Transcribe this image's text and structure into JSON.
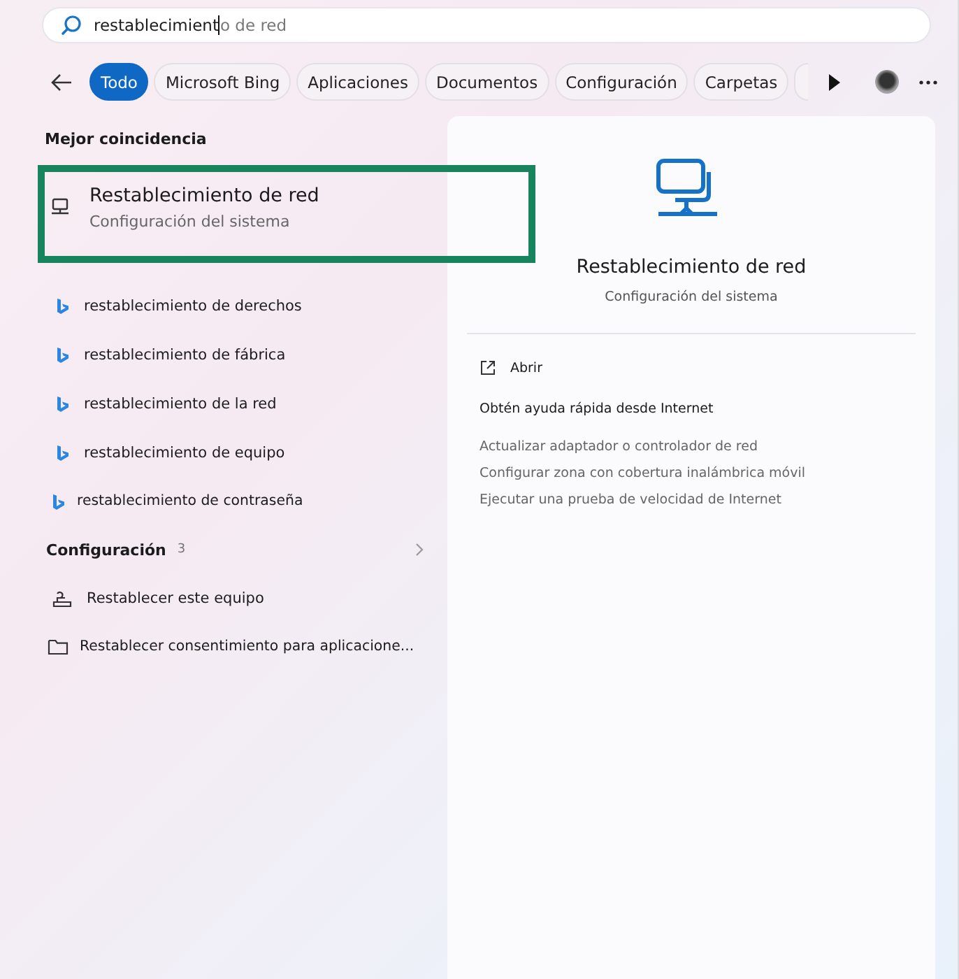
{
  "search": {
    "typed": "restablecimient",
    "completion": "o de red"
  },
  "filters": [
    {
      "label": "Todo",
      "selected": true
    },
    {
      "label": "Microsoft Bing",
      "selected": false
    },
    {
      "label": "Aplicaciones",
      "selected": false
    },
    {
      "label": "Documentos",
      "selected": false
    },
    {
      "label": "Configuración",
      "selected": false
    },
    {
      "label": "Carpetas",
      "selected": false
    }
  ],
  "best_match": {
    "heading": "Mejor coincidencia",
    "title": "Restablecimiento de red",
    "subtitle": "Configuración del sistema",
    "highlighted": true
  },
  "web_suggestions": [
    "restablecimiento de derechos",
    "restablecimiento de fábrica",
    "restablecimiento de la red",
    "restablecimiento de equipo",
    "restablecimiento de contraseña"
  ],
  "settings_section": {
    "heading": "Configuración",
    "count": "3",
    "items": [
      {
        "kind": "reset",
        "label": "Restablecer este equipo"
      },
      {
        "kind": "folder",
        "label": "Restablecer consentimiento para aplicacione..."
      }
    ]
  },
  "preview": {
    "title": "Restablecimiento de red",
    "subtitle": "Configuración del sistema",
    "open_label": "Abrir",
    "help_heading": "Obtén ayuda rápida desde Internet",
    "help_links": [
      "Actualizar adaptador o controlador de red",
      "Configurar zona con cobertura inalámbrica móvil",
      "Ejecutar una prueba de velocidad de Internet"
    ]
  }
}
